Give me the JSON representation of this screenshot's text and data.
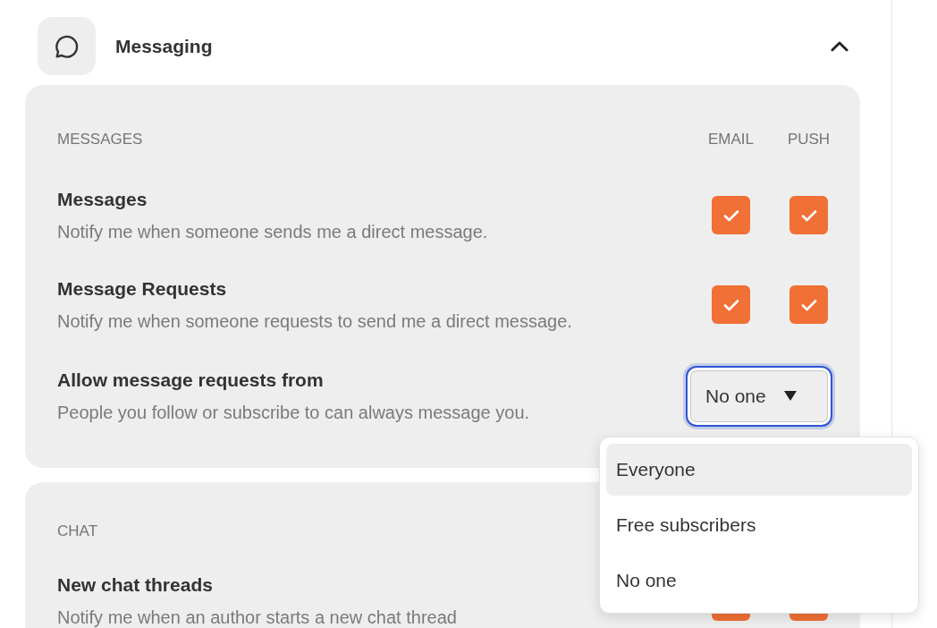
{
  "section": {
    "title": "Messaging",
    "expanded": true
  },
  "groups": [
    {
      "heading": "MESSAGES",
      "columns": [
        "EMAIL",
        "PUSH"
      ],
      "rows": [
        {
          "kind": "checkbox",
          "title": "Messages",
          "description": "Notify me when someone sends me a direct message.",
          "email": true,
          "push": true
        },
        {
          "kind": "checkbox",
          "title": "Message Requests",
          "description": "Notify me when someone requests to send me a direct message.",
          "email": true,
          "push": true
        },
        {
          "kind": "select",
          "title": "Allow message requests from",
          "description": "People you follow or subscribe to can always message you.",
          "value": "No one",
          "focused": true
        }
      ]
    },
    {
      "heading": "CHAT",
      "rows": [
        {
          "kind": "checkbox",
          "title": "New chat threads",
          "description": "Notify me when an author starts a new chat thread",
          "email": true,
          "push": true
        }
      ]
    }
  ],
  "dropdown": {
    "options": [
      {
        "label": "Everyone",
        "highlighted": true
      },
      {
        "label": "Free subscribers",
        "highlighted": false
      },
      {
        "label": "No one",
        "highlighted": false
      }
    ]
  }
}
